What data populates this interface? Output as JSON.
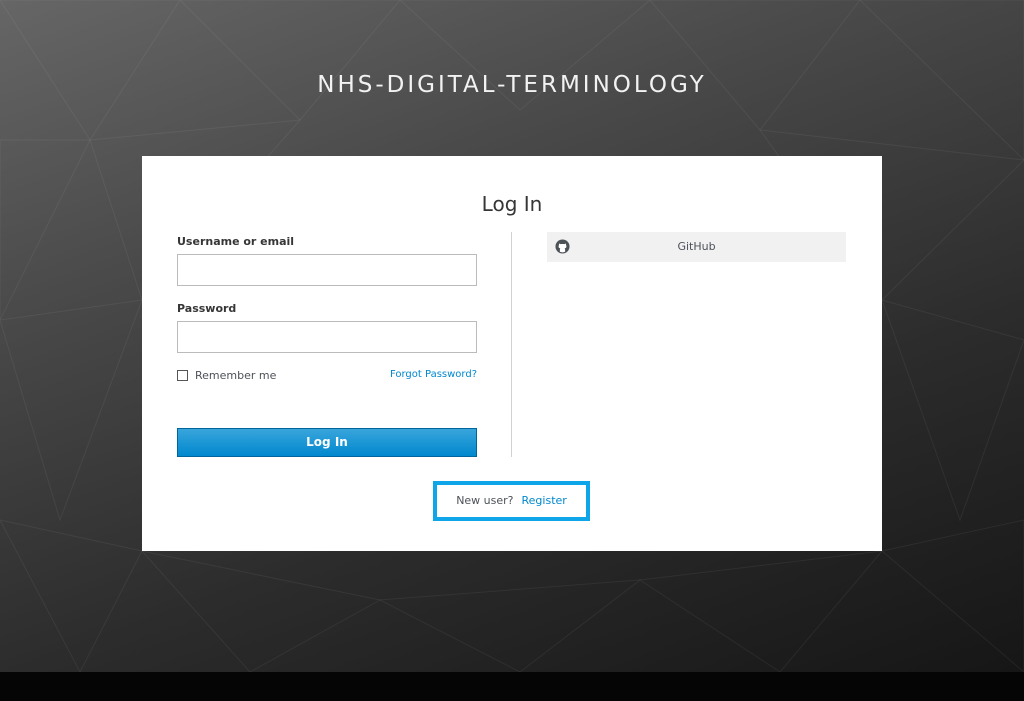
{
  "header": {
    "realm_title": "NHS-DIGITAL-TERMINOLOGY"
  },
  "login": {
    "title": "Log In",
    "username_label": "Username or email",
    "username_value": "",
    "password_label": "Password",
    "password_value": "",
    "remember_me_label": "Remember me",
    "remember_me_checked": false,
    "forgot_password_label": "Forgot Password?",
    "submit_label": "Log In"
  },
  "identity_providers": [
    {
      "label": "GitHub",
      "icon": "github-icon"
    }
  ],
  "registration": {
    "prompt": "New user?",
    "link_label": "Register"
  },
  "colors": {
    "accent": "#0088ce",
    "highlight_border": "#0ea5e9",
    "card_background": "#ffffff",
    "page_background": "#2c2c2c"
  }
}
